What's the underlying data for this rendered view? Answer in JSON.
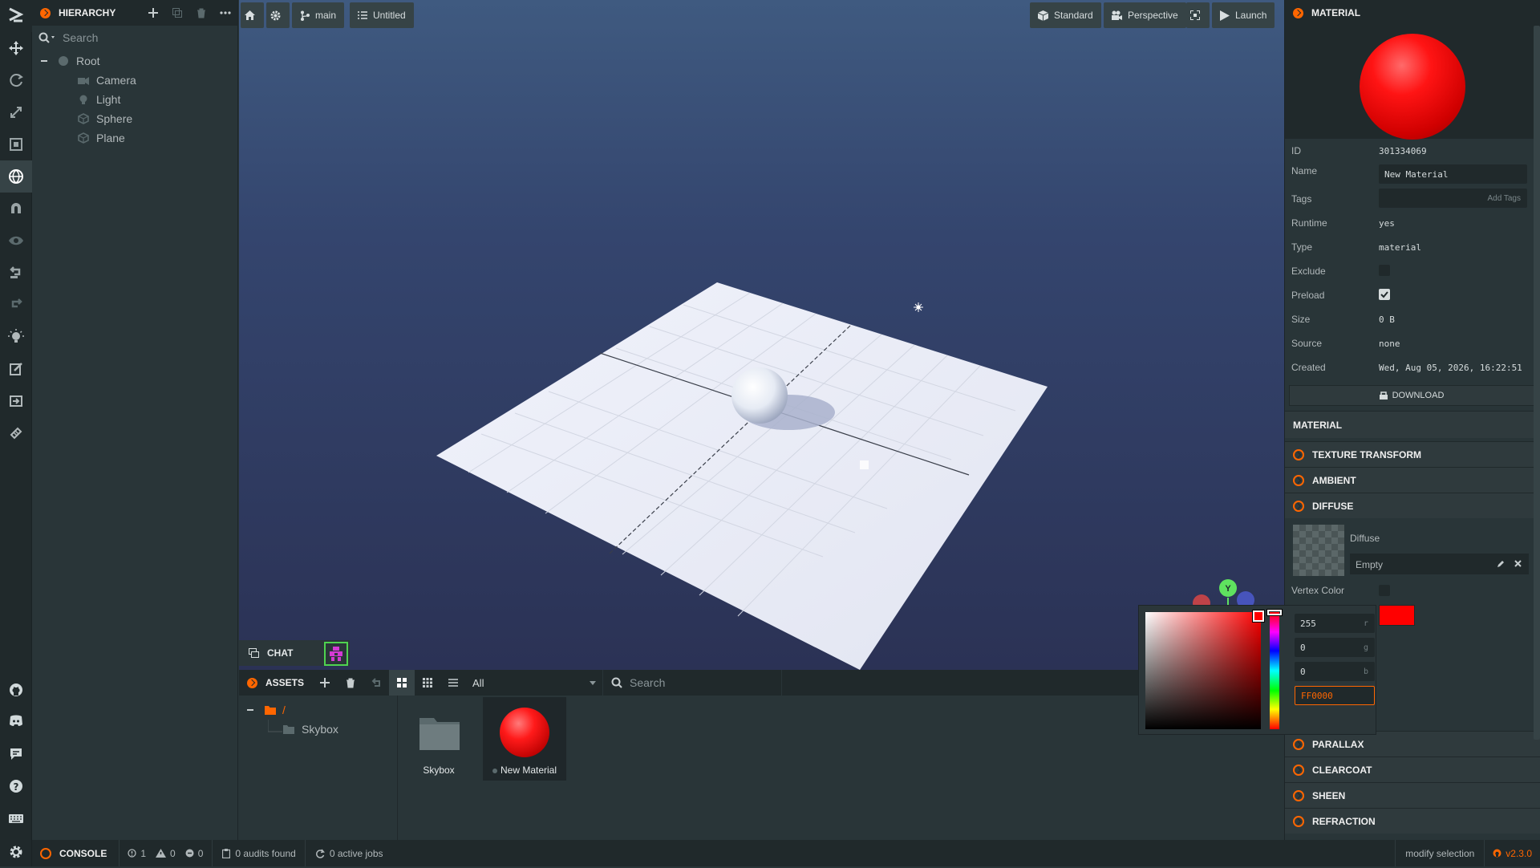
{
  "hierarchy": {
    "title": "HIERARCHY",
    "search_placeholder": "Search",
    "items": [
      {
        "label": "Root"
      },
      {
        "label": "Camera"
      },
      {
        "label": "Light"
      },
      {
        "label": "Sphere"
      },
      {
        "label": "Plane"
      }
    ]
  },
  "viewport_toolbar": {
    "branch": "main",
    "scene": "Untitled",
    "render_mode": "Standard",
    "camera": "Perspective",
    "launch": "Launch"
  },
  "gizmo": {
    "axis_y": "Y"
  },
  "chat": {
    "label": "CHAT"
  },
  "assets": {
    "title": "ASSETS",
    "filter": "All",
    "search_placeholder": "Search",
    "tree_root": "/",
    "tree_folder": "Skybox",
    "items": [
      {
        "label": "Skybox",
        "type": "folder"
      },
      {
        "label": "New Material",
        "type": "material"
      }
    ]
  },
  "inspector": {
    "header": "MATERIAL",
    "id_label": "ID",
    "id_value": "301334069",
    "name_label": "Name",
    "name_value": "New Material",
    "tags_label": "Tags",
    "tags_placeholder": "Add Tags",
    "runtime_label": "Runtime",
    "runtime_value": "yes",
    "type_label": "Type",
    "type_value": "material",
    "exclude_label": "Exclude",
    "preload_label": "Preload",
    "size_label": "Size",
    "size_value": "0 B",
    "source_label": "Source",
    "source_value": "none",
    "created_label": "Created",
    "created_value": "Wed, Aug 05, 2026, 16:22:51",
    "download": "DOWNLOAD",
    "material_section": "MATERIAL",
    "sections": {
      "texture_transform": "TEXTURE TRANSFORM",
      "ambient": "AMBIENT",
      "diffuse": "DIFFUSE",
      "parallax": "PARALLAX",
      "clearcoat": "CLEARCOAT",
      "sheen": "SHEEN",
      "refraction": "REFRACTION"
    },
    "diffuse_label": "Diffuse",
    "diffuse_value": "Empty",
    "vertex_color_label": "Vertex Color",
    "preview_color": "#ff0000"
  },
  "color_picker": {
    "r": "255",
    "r_suffix": "r",
    "g": "0",
    "g_suffix": "g",
    "b": "0",
    "b_suffix": "b",
    "hex": "FF0000"
  },
  "status": {
    "console": "CONSOLE",
    "info_count": "1",
    "warn_count": "0",
    "error_count": "0",
    "audits": "0 audits found",
    "jobs": "0 active jobs",
    "selection": "modify selection",
    "version": "v2.3.0"
  },
  "colors": {
    "accent": "#ff6600",
    "material": "#ff0000"
  }
}
